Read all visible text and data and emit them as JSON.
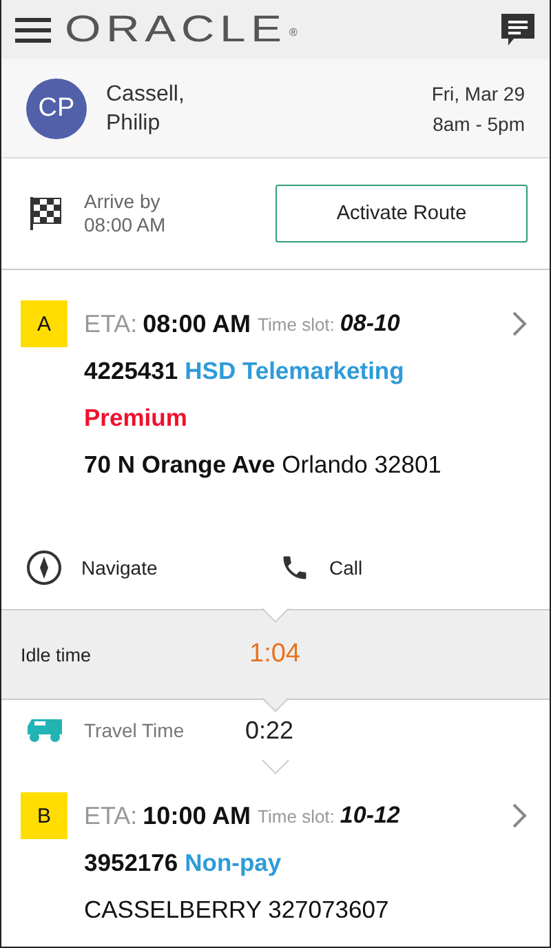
{
  "header": {
    "logo": "ORACLE",
    "logo_mark": "®"
  },
  "user": {
    "initials": "CP",
    "name_line1": "Cassell,",
    "name_line2": "Philip",
    "date": "Fri, Mar 29",
    "hours": "8am - 5pm"
  },
  "route": {
    "arrive_label": "Arrive by",
    "arrive_time": "08:00 AM",
    "button": "Activate Route"
  },
  "items": [
    {
      "kind": "activity",
      "letter": "A",
      "eta_label": "ETA:",
      "eta": "08:00 AM",
      "slot_label": "Time slot:",
      "slot": "08-10",
      "number": "4225431",
      "type": "HSD Telemarketing",
      "priority": "Premium",
      "address": "**70 N Orange Ave** Orlando 32801",
      "actions": [
        {
          "kind": "navigate",
          "label": "Navigate"
        },
        {
          "kind": "call",
          "label": "Call"
        }
      ]
    },
    {
      "kind": "idle",
      "label": "Idle time",
      "value": "1:04"
    },
    {
      "kind": "travel",
      "label": "Travel Time",
      "value": "0:22"
    },
    {
      "kind": "activity",
      "letter": "B",
      "eta_label": "ETA:",
      "eta": "10:00 AM",
      "slot_label": "Time slot:",
      "slot": "10-12",
      "number": "3952176",
      "type": "Non-pay",
      "address": "CASSELBERRY 327073607"
    }
  ]
}
